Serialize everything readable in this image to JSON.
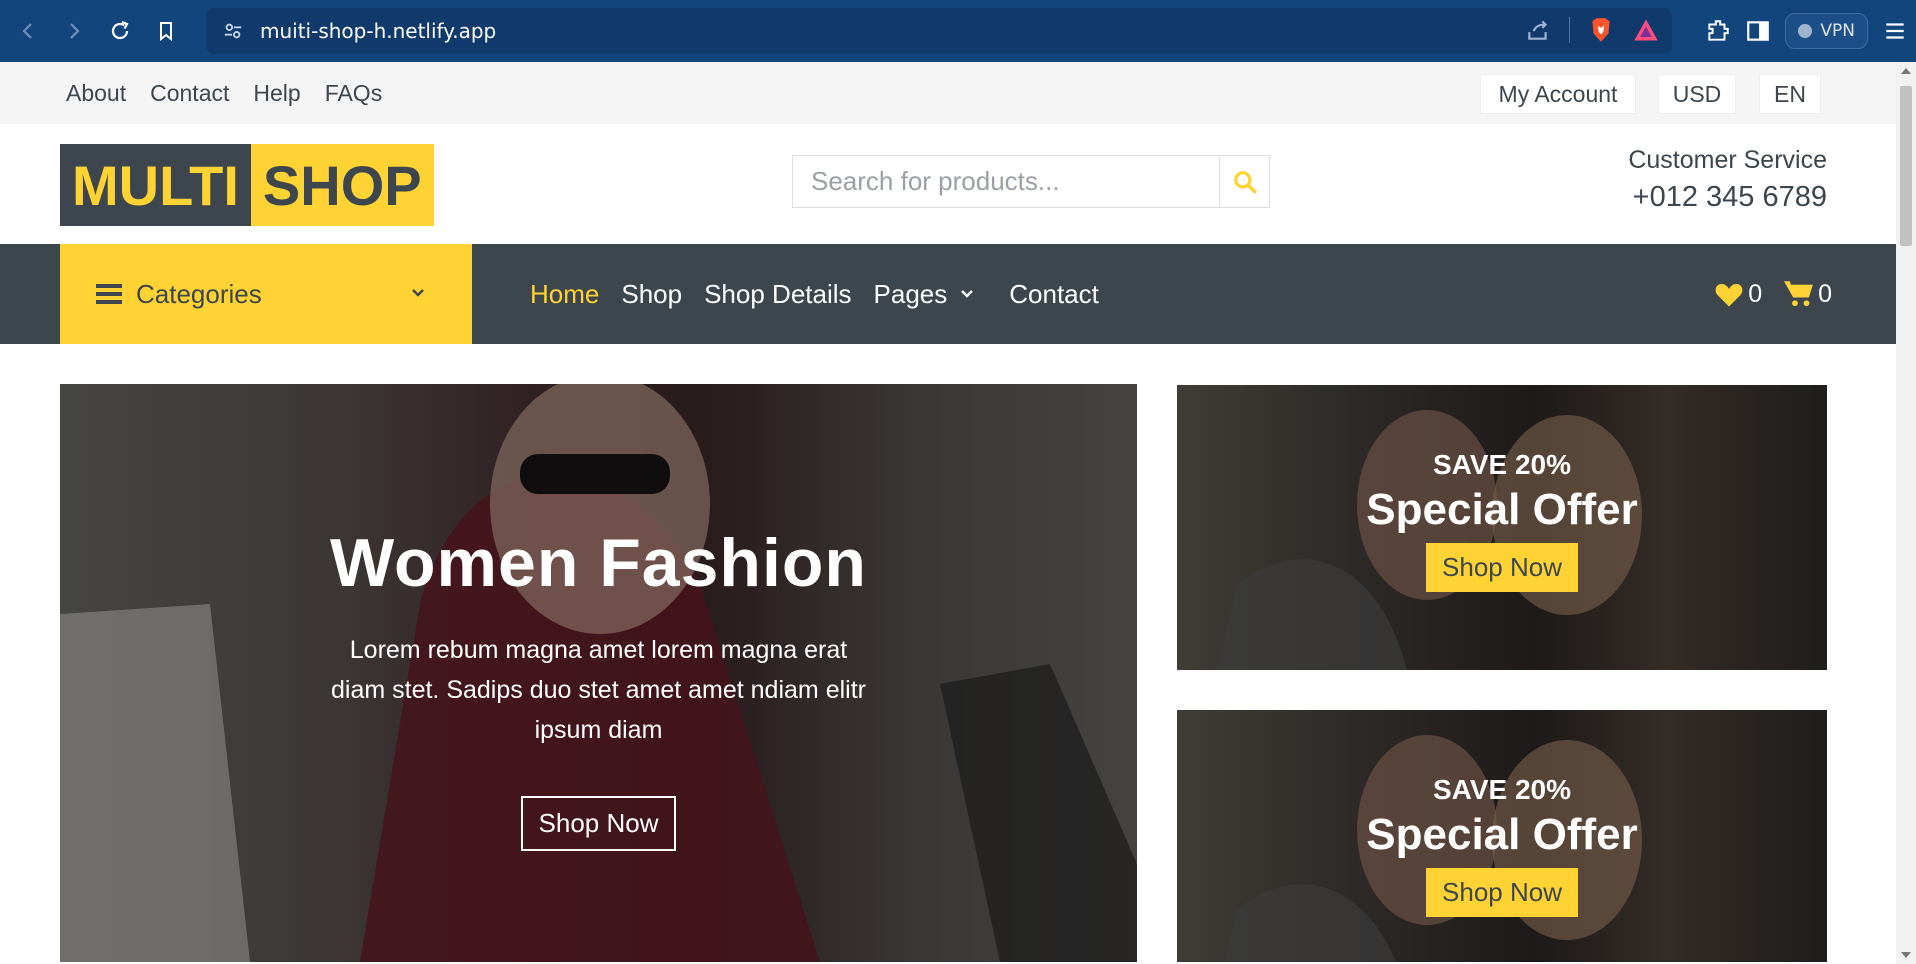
{
  "browser": {
    "url": "muiti-shop-h.netlify.app",
    "vpn_label": "VPN"
  },
  "topbar": {
    "links": [
      "About",
      "Contact",
      "Help",
      "FAQs"
    ],
    "my_account": "My Account",
    "currency": "USD",
    "language": "EN"
  },
  "header": {
    "logo_part1": "MULTI",
    "logo_part2": "SHOP",
    "search_placeholder": "Search for products...",
    "customer_service_label": "Customer Service",
    "customer_service_phone": "+012 345 6789"
  },
  "navbar": {
    "categories_label": "Categories",
    "menu": [
      "Home",
      "Shop",
      "Shop Details",
      "Pages",
      "Contact"
    ],
    "wishlist_count": "0",
    "cart_count": "0"
  },
  "hero": {
    "title": "Women Fashion",
    "text": "Lorem rebum magna amet lorem magna erat diam stet. Sadips duo stet amet amet ndiam elitr ipsum diam",
    "button": "Shop Now"
  },
  "offers": [
    {
      "subtitle": "SAVE 20%",
      "title": "Special Offer",
      "button": "Shop Now"
    },
    {
      "subtitle": "SAVE 20%",
      "title": "Special Offer",
      "button": "Shop Now"
    }
  ],
  "colors": {
    "primary": "#ffd333",
    "dark": "#3d464d",
    "browser_bar": "#13457d"
  }
}
